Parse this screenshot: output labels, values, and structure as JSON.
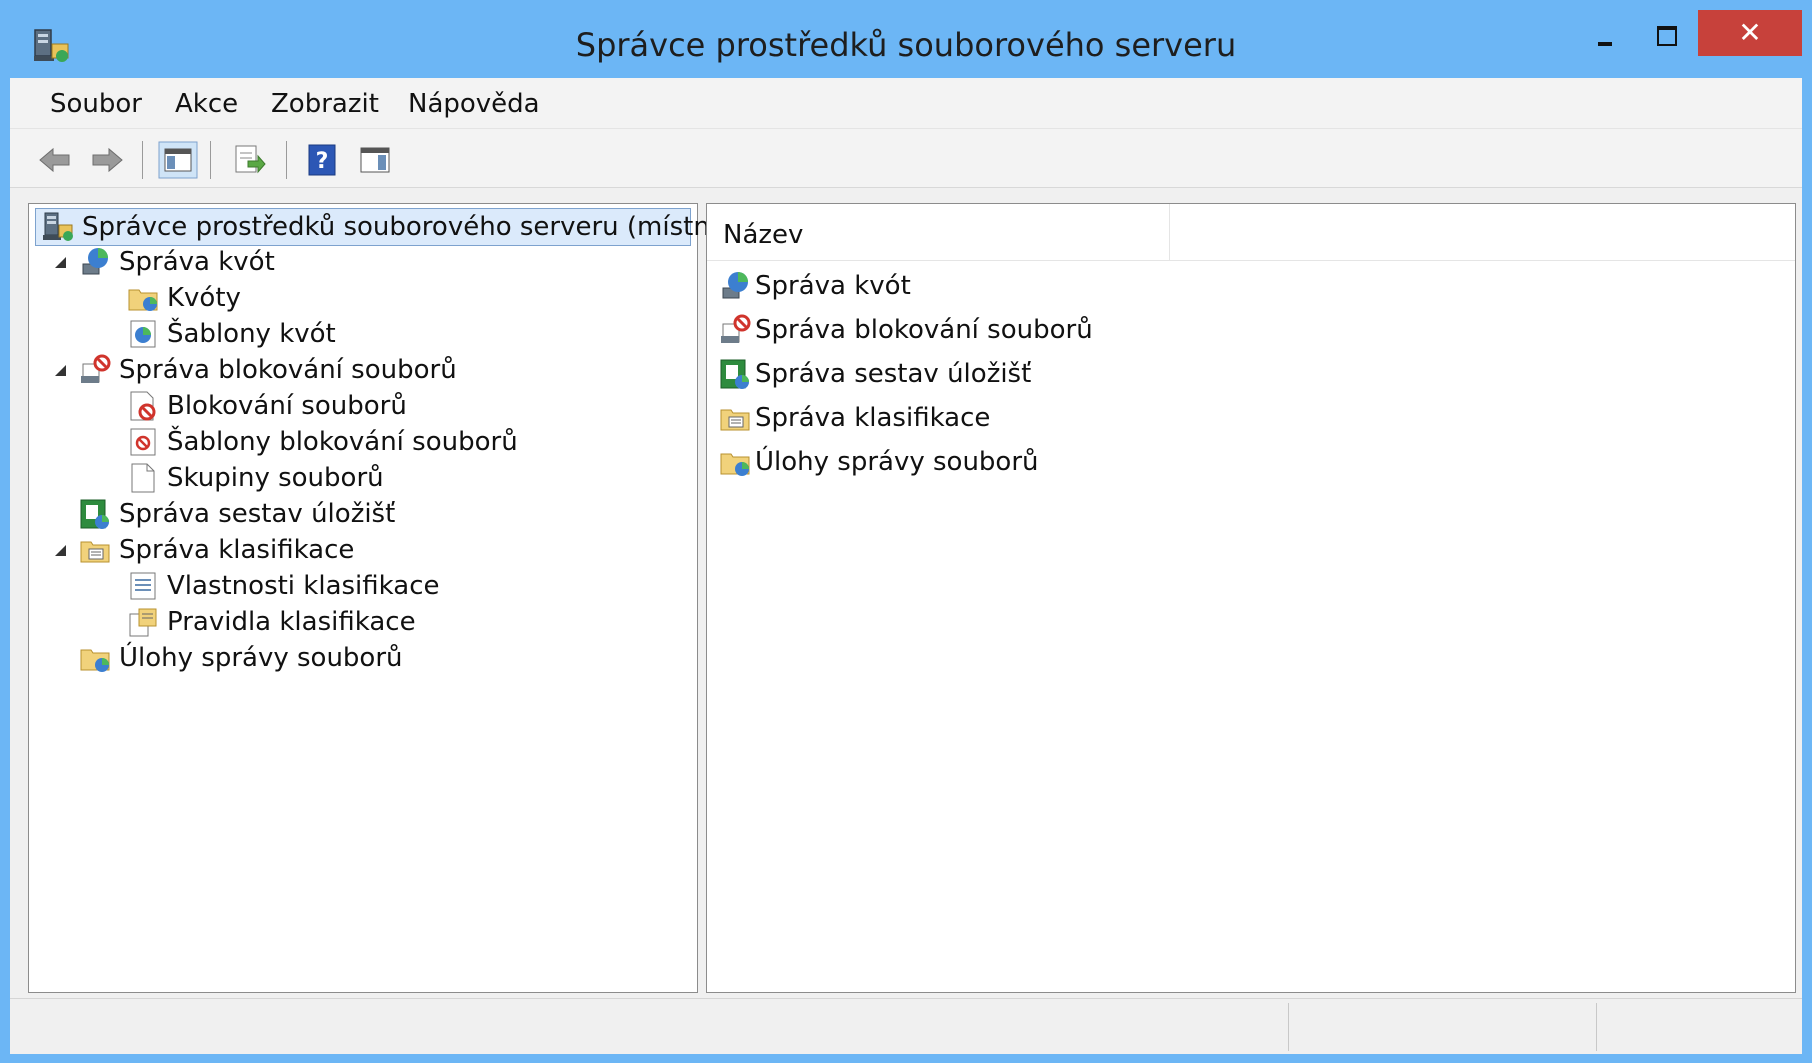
{
  "window": {
    "title": "Správce prostředků souborového serveru",
    "close_glyph": "✕"
  },
  "menu": {
    "items": [
      "Soubor",
      "Akce",
      "Zobrazit",
      "Nápověda"
    ]
  },
  "toolbar": {
    "buttons": [
      "back-icon",
      "forward-icon",
      "show-hide-console-tree-icon",
      "export-list-icon",
      "help-icon",
      "show-hide-action-pane-icon"
    ]
  },
  "tree": {
    "root": "Správce prostředků souborového serveru (místní)",
    "items": [
      {
        "label": "Správa kvót",
        "icon": "quota-management-icon",
        "expanded": true
      },
      {
        "label": "Kvóty",
        "icon": "quotas-folder-icon"
      },
      {
        "label": "Šablony kvót",
        "icon": "quota-templates-icon"
      },
      {
        "label": "Správa blokování souborů",
        "icon": "file-screening-management-icon",
        "expanded": true
      },
      {
        "label": "Blokování souborů",
        "icon": "file-screens-icon"
      },
      {
        "label": "Šablony blokování souborů",
        "icon": "file-screen-templates-icon"
      },
      {
        "label": "Skupiny souborů",
        "icon": "file-groups-icon"
      },
      {
        "label": "Správa sestav úložišť",
        "icon": "storage-reports-icon"
      },
      {
        "label": "Správa klasifikace",
        "icon": "classification-management-icon",
        "expanded": true
      },
      {
        "label": "Vlastnosti klasifikace",
        "icon": "classification-properties-icon"
      },
      {
        "label": "Pravidla klasifikace",
        "icon": "classification-rules-icon"
      },
      {
        "label": "Úlohy správy souborů",
        "icon": "file-management-tasks-icon"
      }
    ]
  },
  "list": {
    "column": "Název",
    "items": [
      {
        "label": "Správa kvót",
        "icon": "quota-management-icon"
      },
      {
        "label": "Správa blokování souborů",
        "icon": "file-screening-management-icon"
      },
      {
        "label": "Správa sestav úložišť",
        "icon": "storage-reports-icon"
      },
      {
        "label": "Správa klasifikace",
        "icon": "classification-management-icon"
      },
      {
        "label": "Úlohy správy souborů",
        "icon": "file-management-tasks-icon"
      }
    ]
  },
  "colors": {
    "frame": "#6cb6f5",
    "close": "#c7413b",
    "selection": "#dbeafb"
  }
}
